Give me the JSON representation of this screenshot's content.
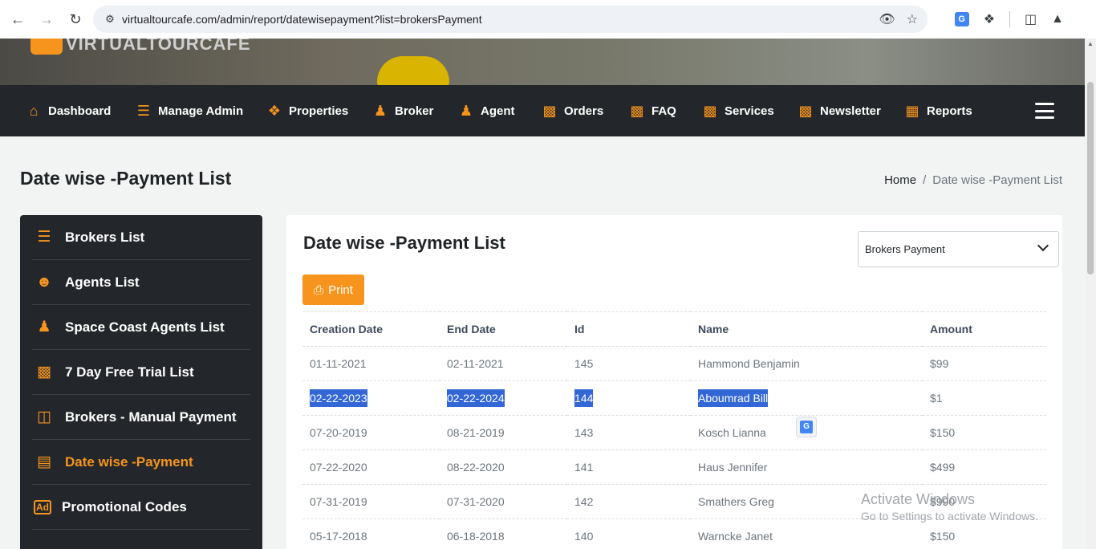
{
  "browser": {
    "url": "virtualtourcafe.com/admin/report/datewisepayment?list=brokersPayment"
  },
  "brand": {
    "logo_text": "VIRTUALTOURCAFE"
  },
  "nav": [
    {
      "label": "Dashboard",
      "icon": "home-icon"
    },
    {
      "label": "Manage Admin",
      "icon": "admin-icon"
    },
    {
      "label": "Properties",
      "icon": "properties-icon"
    },
    {
      "label": "Broker",
      "icon": "broker-icon"
    },
    {
      "label": "Agent",
      "icon": "agent-icon"
    },
    {
      "label": "Orders",
      "icon": "clipboard-icon"
    },
    {
      "label": "FAQ",
      "icon": "clipboard-icon"
    },
    {
      "label": "Services",
      "icon": "clipboard-icon"
    },
    {
      "label": "Newsletter",
      "icon": "clipboard-icon"
    },
    {
      "label": "Reports",
      "icon": "reports-icon"
    }
  ],
  "page": {
    "title": "Date wise -Payment List",
    "breadcrumb": {
      "home": "Home",
      "separator": "/",
      "current": "Date wise -Payment List"
    }
  },
  "sidebar": [
    {
      "label": "Brokers List",
      "icon": "list-icon",
      "active": false
    },
    {
      "label": "Agents List",
      "icon": "user-icon",
      "active": false
    },
    {
      "label": "Space Coast Agents List",
      "icon": "users-icon",
      "active": false
    },
    {
      "label": "7 Day Free Trial List",
      "icon": "clipboard-icon",
      "active": false
    },
    {
      "label": "Brokers - Manual Payment",
      "icon": "money-icon",
      "active": false
    },
    {
      "label": "Date wise -Payment",
      "icon": "credit-card-icon",
      "active": true
    },
    {
      "label": "Promotional Codes",
      "icon": "ad-icon",
      "active": false
    }
  ],
  "card": {
    "title": "Date wise -Payment List",
    "select_value": "Brokers Payment",
    "print_label": "Print"
  },
  "table": {
    "headers": [
      "Creation Date",
      "End Date",
      "Id",
      "Name",
      "Amount"
    ],
    "rows": [
      [
        "01-11-2021",
        "02-11-2021",
        "145",
        "Hammond Benjamin",
        "$99"
      ],
      [
        "02-22-2023",
        "02-22-2024",
        "144",
        "Aboumrad Bill",
        "$1"
      ],
      [
        "07-20-2019",
        "08-21-2019",
        "143",
        "Kosch Lianna",
        "$150"
      ],
      [
        "07-22-2020",
        "08-22-2020",
        "141",
        "Haus Jennifer",
        "$499"
      ],
      [
        "07-31-2019",
        "07-31-2020",
        "142",
        "Smathers Greg",
        "$990"
      ],
      [
        "05-17-2018",
        "06-18-2018",
        "140",
        "Warncke Janet",
        "$150"
      ]
    ]
  },
  "watermark": {
    "line1": "Activate Windows",
    "line2": "Go to Settings to activate Windows."
  },
  "colors": {
    "accent": "#f7941d",
    "nav_bg": "#23272b",
    "selection": "#3367d6"
  }
}
